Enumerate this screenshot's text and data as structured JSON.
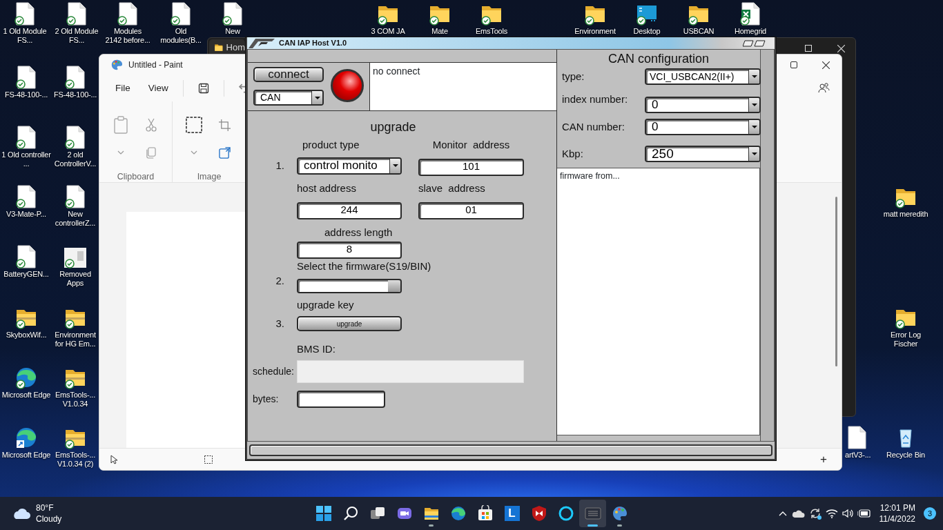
{
  "desktop": {
    "top_icons": [
      {
        "label": "1 Old Module FS...",
        "kind": "file",
        "synced": true
      },
      {
        "label": "2 Old Module FS...",
        "kind": "file",
        "synced": true
      },
      {
        "label": "Modules 2142 before...",
        "kind": "file",
        "synced": true
      },
      {
        "label": "Old modules(B...",
        "kind": "file",
        "synced": true
      },
      {
        "label": "New",
        "kind": "file",
        "synced": true
      },
      {
        "label": "3 COM JA",
        "kind": "folder",
        "synced": true
      },
      {
        "label": "Mate",
        "kind": "folder",
        "synced": true
      },
      {
        "label": "EmsTools",
        "kind": "folder",
        "synced": true
      },
      {
        "label": "Environment",
        "kind": "folder",
        "synced": true
      },
      {
        "label": "Desktop",
        "kind": "monitor",
        "synced": true
      },
      {
        "label": "USBCAN",
        "kind": "folder",
        "synced": true
      },
      {
        "label": "Homegrid",
        "kind": "excel",
        "synced": true
      }
    ],
    "left_icons": [
      {
        "label": "FS-48-100-...",
        "kind": "file",
        "synced": true,
        "shortcut": false
      },
      {
        "label": "FS-48-100-...",
        "kind": "file",
        "synced": true,
        "shortcut": false
      },
      {
        "label": "1 Old controller ...",
        "kind": "file",
        "synced": true,
        "shortcut": false
      },
      {
        "label": "2 old ControllerV...",
        "kind": "file",
        "synced": true,
        "shortcut": false
      },
      {
        "label": "V3-Mate-P...",
        "kind": "file",
        "synced": true,
        "shortcut": false
      },
      {
        "label": "New controllerZ...",
        "kind": "file",
        "synced": true,
        "shortcut": false
      },
      {
        "label": "BatteryGEN...",
        "kind": "file",
        "synced": true,
        "shortcut": false
      },
      {
        "label": "Removed Apps",
        "kind": "removed",
        "synced": true,
        "shortcut": false
      },
      {
        "label": "SkyboxWif...",
        "kind": "zip",
        "synced": true,
        "shortcut": false
      },
      {
        "label": "Environment for HG Em...",
        "kind": "zip",
        "synced": true,
        "shortcut": false
      },
      {
        "label": "Microsoft Edge",
        "kind": "edge",
        "synced": true,
        "shortcut": false
      },
      {
        "label": "EmsTools-... V1.0.34",
        "kind": "zip",
        "synced": true,
        "shortcut": false
      },
      {
        "label": "Microsoft Edge",
        "kind": "edge",
        "synced": false,
        "shortcut": true
      },
      {
        "label": "EmsTools-... V1.0.34 (2)",
        "kind": "zip",
        "synced": true,
        "shortcut": false
      }
    ],
    "right_icons": [
      {
        "label": "matt meredith",
        "kind": "folder",
        "synced": true
      },
      {
        "label": "Error Log Fischer",
        "kind": "folder",
        "synced": true
      },
      {
        "label": "artV3-...",
        "kind": "file"
      },
      {
        "label": "Recycle Bin",
        "kind": "recycle",
        "synced": false
      }
    ]
  },
  "explorer_window": {
    "tab": "Hom"
  },
  "paint_window": {
    "title": "Untitled - Paint",
    "menus": [
      "File",
      "View"
    ],
    "ribbon_groups": [
      "Clipboard",
      "Image"
    ],
    "zoom_in": "+"
  },
  "can_window": {
    "title": "CAN IAP Host V1.0",
    "connect_button": "connect",
    "interface": "CAN",
    "connected": false,
    "status": "no connect",
    "upgrade": {
      "title": "upgrade",
      "steps": [
        "1.",
        "2.",
        "3."
      ],
      "product_type": {
        "label": "product type",
        "value": "control monito"
      },
      "monitor_address": {
        "label": "Monitor  address",
        "value": "101"
      },
      "host_address": {
        "label": "host address",
        "value": "244"
      },
      "slave_address": {
        "label": "slave  address",
        "value": "01"
      },
      "address_length": {
        "label": "address length",
        "value": "8"
      },
      "firmware": {
        "label": "Select the firmware(S19/BIN)"
      },
      "upgrade_key": {
        "label": "upgrade key",
        "button": "upgrade"
      },
      "bms_id": "BMS ID:",
      "schedule": {
        "label": "schedule:",
        "level": 0
      },
      "bytes": {
        "label": "bytes:"
      }
    },
    "config": {
      "title": "CAN configuration",
      "fields": [
        {
          "label": "type:",
          "value": "VCI_USBCAN2(II+)"
        },
        {
          "label": "index number:",
          "value": "0"
        },
        {
          "label": "CAN number:",
          "value": "0"
        },
        {
          "label": "Kbp:",
          "value": "250"
        }
      ]
    },
    "log": "firmware from..."
  },
  "taskbar": {
    "weather": {
      "temperature": "80°F",
      "condition": "Cloudy"
    },
    "apps": [
      {
        "kind": "start",
        "running": false,
        "selected": false
      },
      {
        "kind": "search",
        "running": false,
        "selected": false
      },
      {
        "kind": "taskview",
        "running": false,
        "selected": false
      },
      {
        "kind": "chat",
        "running": false,
        "selected": false
      },
      {
        "kind": "explorer",
        "running": true,
        "selected": false
      },
      {
        "kind": "edge",
        "running": false,
        "selected": false
      },
      {
        "kind": "store",
        "running": false,
        "selected": false
      },
      {
        "kind": "letter",
        "label": "L",
        "running": false,
        "selected": false
      },
      {
        "kind": "shield",
        "running": false,
        "selected": false
      },
      {
        "kind": "ring",
        "running": false,
        "selected": false
      },
      {
        "kind": "canapp",
        "running": true,
        "selected": true
      },
      {
        "kind": "paint",
        "running": true,
        "selected": false
      }
    ],
    "clock": {
      "time": "12:01 PM",
      "date": "11/4/2022"
    },
    "notifications": "3"
  }
}
